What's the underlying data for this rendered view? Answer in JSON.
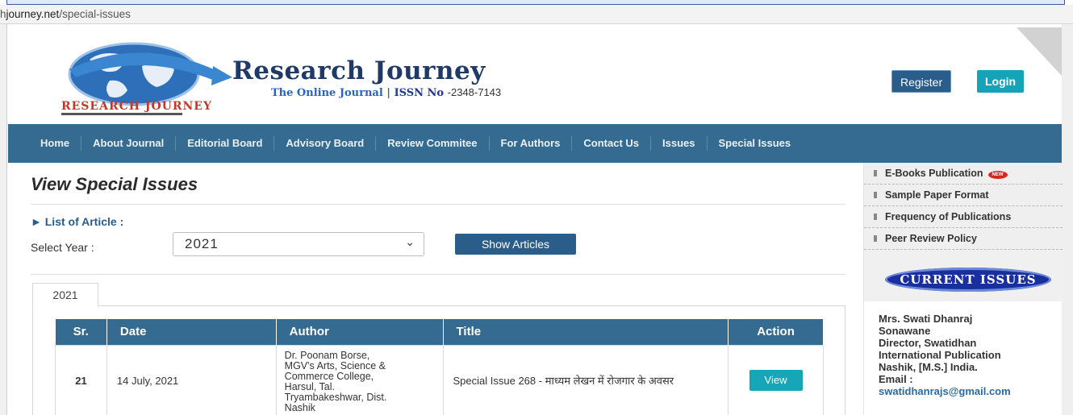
{
  "browser": {
    "url_host": "journey.net",
    "url_path": "/special-issues",
    "url_prefix": "h"
  },
  "header": {
    "title": "Research Journey",
    "subtitle": "The Online Journal",
    "separator": "|",
    "issn_label": "ISSN No",
    "issn_value": "-2348-7143",
    "logo_text": "RESEARCH JOURNEY",
    "register_label": "Register",
    "login_label": "Login"
  },
  "nav": {
    "items": [
      "Home",
      "About Journal",
      "Editorial Board",
      "Advisory Board",
      "Review Commitee",
      "For Authors",
      "Contact Us",
      "Issues",
      "Special Issues"
    ]
  },
  "main": {
    "title": "View Special Issues",
    "list_heading": "► List of Article :",
    "select_label": "Select Year :",
    "selected_year": "2021",
    "show_button": "Show Articles",
    "active_tab": "2021"
  },
  "table": {
    "headers": {
      "sr": "Sr.",
      "date": "Date",
      "author": "Author",
      "title": "Title",
      "action": "Action"
    },
    "rows": [
      {
        "sr": "21",
        "date": "14 July, 2021",
        "author_lines": [
          "Dr. Poonam Borse,",
          "MGV's Arts, Science &",
          "Commerce College,",
          "Harsul, Tal.",
          "Tryambakeshwar, Dist.",
          "Nashik"
        ],
        "title": "Special Issue 268 - माध्यम लेखन में रोजगार के अवसर",
        "action": "View"
      }
    ]
  },
  "sidebar": {
    "links": [
      {
        "label": "E-Books Publication",
        "badge": "NEW"
      },
      {
        "label": "Sample Paper Format"
      },
      {
        "label": "Frequency of Publications"
      },
      {
        "label": "Peer Review Policy"
      }
    ],
    "current_issues_label": "CURRENT ISSUES",
    "contact": {
      "name_line1": "Mrs. Swati Dhanraj",
      "name_line2": "Sonawane",
      "role": "Director, Swatidhan",
      "org": "International Publication",
      "place": "Nashik, [M.S.] India.",
      "email_label": "Email :",
      "email": "swatidhanrajs@gmail.com"
    }
  },
  "colors": {
    "nav_bg": "#356a91",
    "accent_teal": "#17a5b8",
    "title_navy": "#1f3a66",
    "badge_blue": "#1a2f9e"
  },
  "icons": [
    "globe-logo-icon",
    "chevron-down-icon",
    "bullet-icon",
    "new-badge-icon"
  ]
}
